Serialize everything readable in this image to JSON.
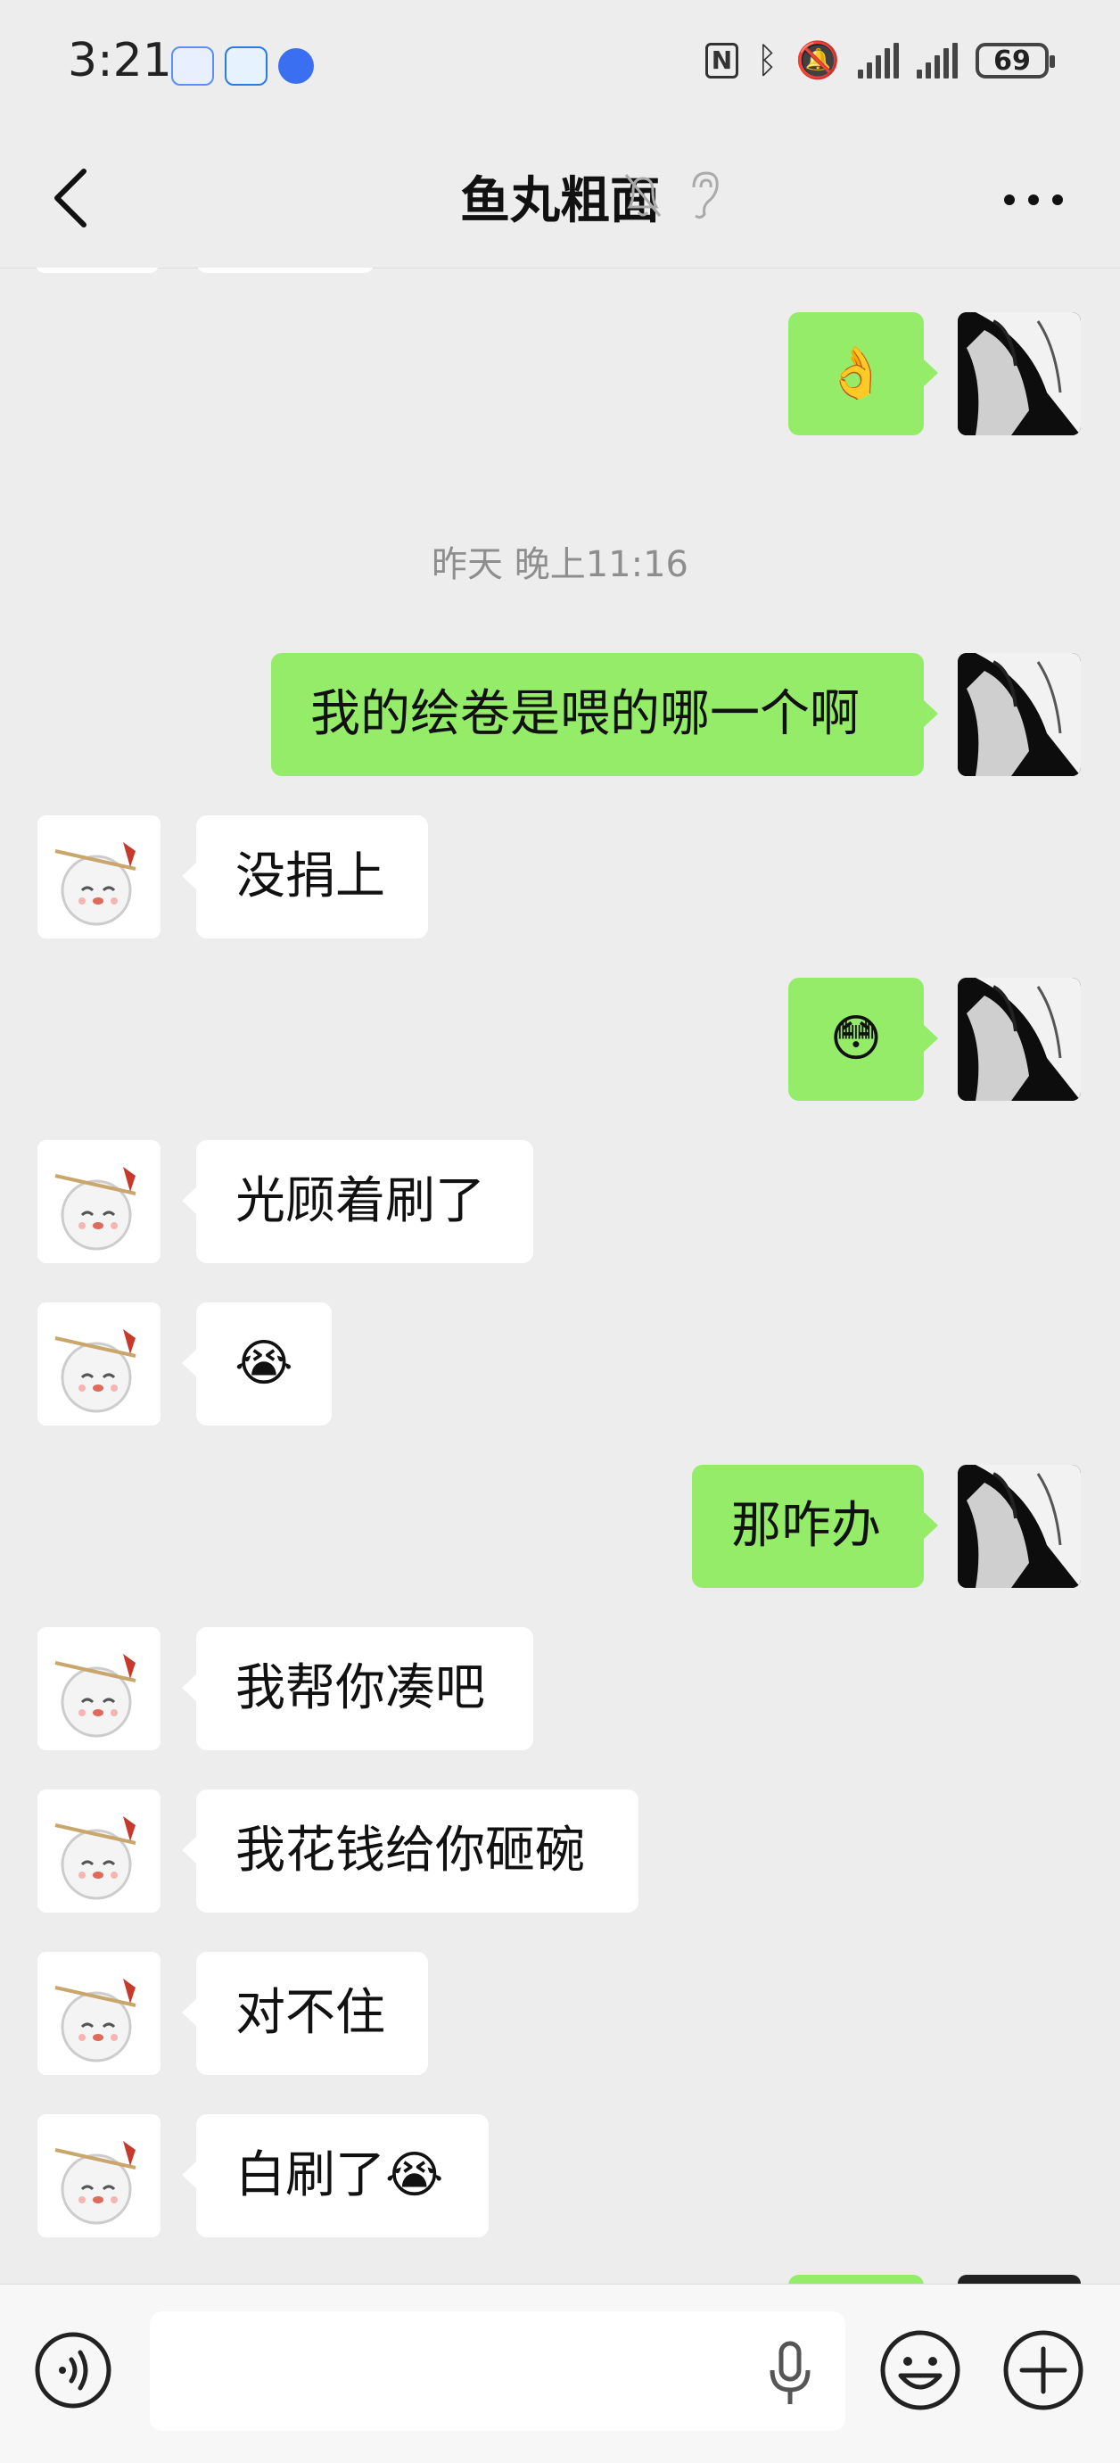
{
  "status_bar": {
    "time": "3:21",
    "battery": "69",
    "icons": [
      "nfc-icon",
      "bluetooth-icon",
      "mute-icon",
      "signal-icon",
      "signal-icon",
      "battery-icon"
    ]
  },
  "header": {
    "title": "鱼丸粗面",
    "icons": [
      "back-chevron-icon",
      "mute-bell-icon",
      "ear-icon",
      "more-icon"
    ]
  },
  "messages": [
    {
      "side": "right",
      "type": "emoji",
      "content": "👌"
    },
    {
      "type": "timestamp",
      "content": "昨天 晚上11:16"
    },
    {
      "side": "right",
      "type": "text",
      "content": "我的绘卷是喂的哪一个啊"
    },
    {
      "side": "left",
      "type": "text",
      "content": "没捐上"
    },
    {
      "side": "right",
      "type": "emoji",
      "content": "😳"
    },
    {
      "side": "left",
      "type": "text",
      "content": "光顾着刷了"
    },
    {
      "side": "left",
      "type": "emoji",
      "content": "😭"
    },
    {
      "side": "right",
      "type": "text",
      "content": "那咋办"
    },
    {
      "side": "left",
      "type": "text",
      "content": "我帮你凑吧"
    },
    {
      "side": "left",
      "type": "text",
      "content": "我花钱给你砸碗"
    },
    {
      "side": "left",
      "type": "text",
      "content": "对不住"
    },
    {
      "side": "left",
      "type": "text",
      "content": "白刷了😭"
    }
  ],
  "input_bar": {
    "value": "",
    "icons": [
      "voice-icon",
      "mic-icon",
      "emoji-icon",
      "plus-icon"
    ]
  },
  "colors": {
    "background": "#ededed",
    "bubble_self": "#95ec69",
    "bubble_other": "#ffffff"
  }
}
